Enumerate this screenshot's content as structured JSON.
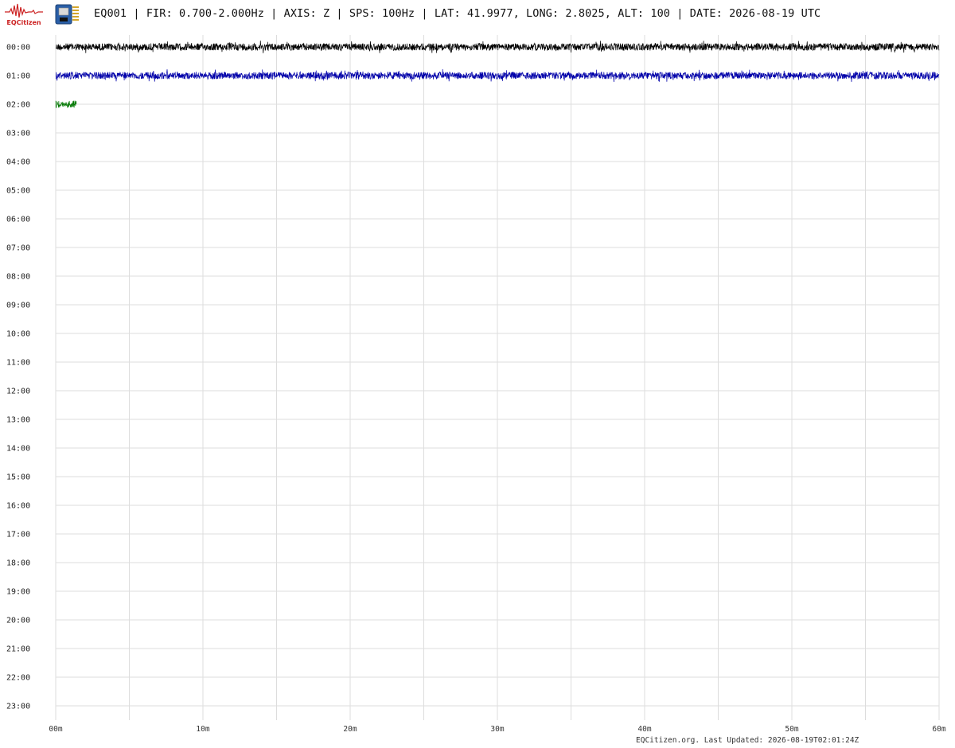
{
  "header": {
    "logo_text": "EQCitizen",
    "title": "EQ001 | FIR: 0.700-2.000Hz | AXIS: Z | SPS: 100Hz | LAT: 41.9977, LONG: 2.8025, ALT: 100 | DATE: 2026-08-19 UTC"
  },
  "footer": {
    "text": "EQCitizen.org. Last Updated: 2026-08-19T02:01:24Z"
  },
  "icons": [
    "eqcitizen-logo-icon",
    "seismometer-board-icon"
  ],
  "colors": {
    "logo_red": "#cc2222",
    "grid": "#dddddd",
    "trace_colors": [
      "#000000",
      "#0000aa",
      "#007700"
    ]
  },
  "chart_data": {
    "type": "line",
    "title": "EQ001 | FIR: 0.700-2.000Hz | AXIS: Z | SPS: 100Hz | LAT: 41.9977, LONG: 2.8025, ALT: 100 | DATE: 2026-08-19 UTC",
    "xlabel": "",
    "ylabel": "",
    "x_unit": "minutes",
    "xlim": [
      0,
      60
    ],
    "x_ticks": [
      "00m",
      "10m",
      "20m",
      "30m",
      "40m",
      "50m",
      "60m"
    ],
    "x_tick_values": [
      0,
      10,
      20,
      30,
      40,
      50,
      60
    ],
    "x_grid_step": 5,
    "grid": true,
    "rows": [
      "00:00",
      "01:00",
      "02:00",
      "03:00",
      "04:00",
      "05:00",
      "06:00",
      "07:00",
      "08:00",
      "09:00",
      "10:00",
      "11:00",
      "12:00",
      "13:00",
      "14:00",
      "15:00",
      "16:00",
      "17:00",
      "18:00",
      "19:00",
      "20:00",
      "21:00",
      "22:00",
      "23:00"
    ],
    "series": [
      {
        "row": "00:00",
        "color": "#000000",
        "x_start": 0,
        "x_end": 60
      },
      {
        "row": "01:00",
        "color": "#0000aa",
        "x_start": 0,
        "x_end": 60
      },
      {
        "row": "02:00",
        "color": "#007700",
        "x_start": 0,
        "x_end": 1.4
      }
    ]
  }
}
